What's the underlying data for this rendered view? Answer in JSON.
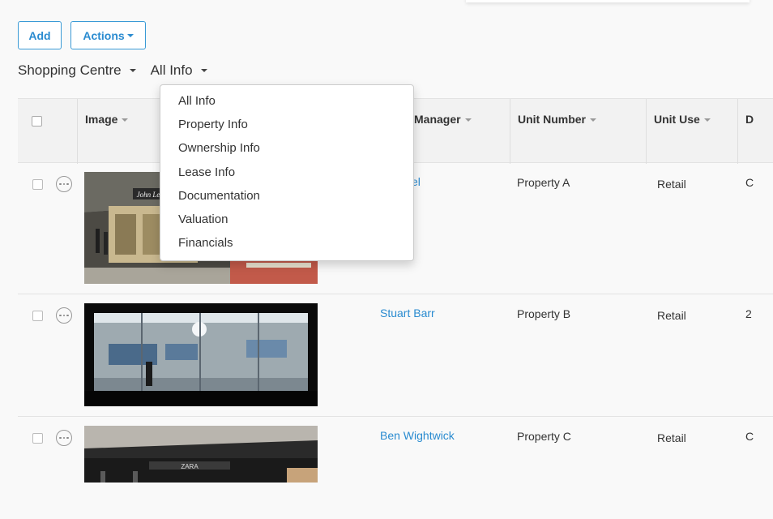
{
  "toolbar": {
    "add_label": "Add",
    "actions_label": "Actions"
  },
  "filters": {
    "group": "Shopping Centre",
    "view": "All Info"
  },
  "table": {
    "columns": [
      "Image",
      "Manager",
      "Unit Number",
      "Unit Use",
      "D"
    ],
    "rows": [
      {
        "manager": "Patel",
        "unit_number": "Property A",
        "unit_use": "Retail",
        "extra": "C"
      },
      {
        "manager": "Stuart Barr",
        "unit_number": "Property B",
        "unit_use": "Retail",
        "extra": "2"
      },
      {
        "manager": "Ben Wightwick",
        "unit_number": "Property C",
        "unit_use": "Retail",
        "extra": "C"
      }
    ],
    "images": [
      {
        "sign_text": "John Lewis"
      },
      {
        "sign_text": ""
      },
      {
        "sign_text": "ZARA"
      }
    ]
  },
  "dropdown": {
    "items": [
      "All Info",
      "Property Info",
      "Ownership Info",
      "Lease Info",
      "Documentation",
      "Valuation",
      "Financials"
    ]
  }
}
